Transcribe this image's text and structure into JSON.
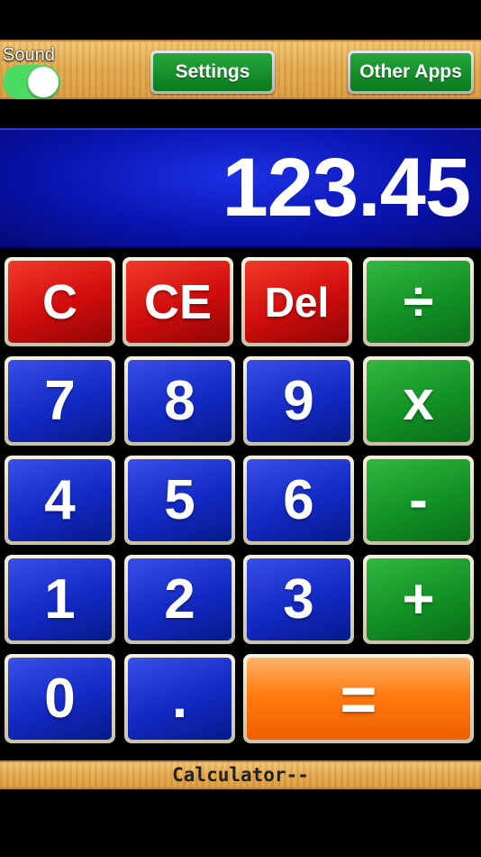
{
  "top": {
    "sound_label": "Sound",
    "sound_on": true,
    "settings_label": "Settings",
    "other_apps_label": "Other Apps"
  },
  "display": {
    "value": "123.45"
  },
  "keys": {
    "clear": "C",
    "clear_entry": "CE",
    "delete": "Del",
    "divide": "÷",
    "seven": "7",
    "eight": "8",
    "nine": "9",
    "multiply": "x",
    "four": "4",
    "five": "5",
    "six": "6",
    "subtract": "-",
    "one": "1",
    "two": "2",
    "three": "3",
    "add": "+",
    "zero": "0",
    "decimal": ".",
    "equals": "="
  },
  "footer": {
    "title": "Calculator--"
  },
  "colors": {
    "clear_keys": "#d11010",
    "digit_keys": "#1329c4",
    "operator_keys": "#129124",
    "equals_key": "#ff7b10",
    "display_bg": "#0a14b0",
    "toggle_on": "#4cd964"
  }
}
